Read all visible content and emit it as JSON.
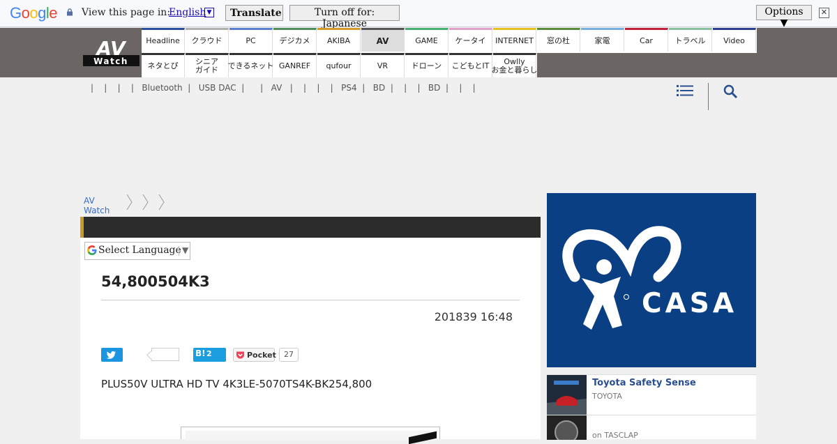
{
  "translate_bar": {
    "logo": "Google",
    "prompt": "View this page in:",
    "language": "English",
    "translate_label": "Translate",
    "turn_off_label": "Turn off for: Japanese",
    "options_label": "Options ▼",
    "close": "✕"
  },
  "site": {
    "logo_top": "AV",
    "logo_bottom": "Watch"
  },
  "nav": {
    "row1": [
      "Headline",
      "クラウド",
      "PC",
      "デジカメ",
      "AKIBA",
      "AV",
      "GAME",
      "ケータイ",
      "INTERNET",
      "窓の杜",
      "家電",
      "Car",
      "トラベル",
      "Video"
    ],
    "row1_colors": [
      "#2b4e9e",
      "#b0b0b0",
      "#5a7fd0",
      "#4f8e5a",
      "#d49a2a",
      "#555555",
      "#48b070",
      "#e0a0c8",
      "#e8c020",
      "#5a8a3a",
      "#74b0e0",
      "#c0203a",
      "#88c0a0",
      "#2b3f8e"
    ],
    "active": "AV",
    "row2": [
      "ネタとぴ",
      "シニア\nガイド",
      "できるネット",
      "GANREF",
      "qufour",
      "VR",
      "ドローン",
      "こどもとIT",
      "Owlly\nお金と暮らし"
    ]
  },
  "subnav": {
    "text": "|    |    |    |   Bluetooth  |   USB DAC  |      |   AV   |    |    |    |   PS4  |   BD  |    |    |   BD  |    |    |"
  },
  "breadcrumb": {
    "home": "AV Watch"
  },
  "article": {
    "language_select": "Select Language",
    "title": "54,800504K3",
    "date": "201839 16:48",
    "hatena_label": "B!",
    "hatena_count": "2",
    "pocket_label": "Pocket",
    "pocket_count": "27",
    "body": "PLUS50V ULTRA HD TV 4K3LE-5070TS4K-BK254,800"
  },
  "sidebar": {
    "ad_brand": "CASA",
    "items": [
      {
        "title": "Toyota Safety Sense",
        "sub": "TOYOTA"
      },
      {
        "title": "",
        "sub": "on TASCLAP"
      }
    ]
  },
  "colors": {
    "header": "#6b6664",
    "accent_link": "#3a6bc7",
    "ad_bg": "#0b3f83",
    "twitter": "#1b95e0"
  }
}
